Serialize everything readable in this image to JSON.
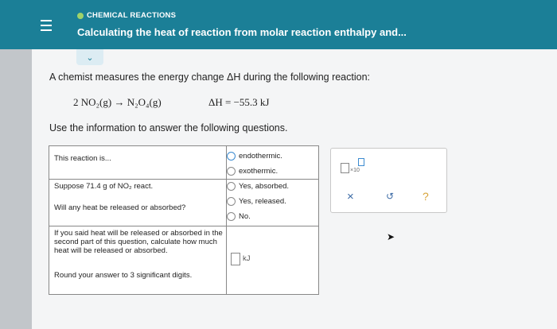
{
  "header": {
    "topic": "CHEMICAL REACTIONS",
    "title": "Calculating the heat of reaction from molar reaction enthalpy and..."
  },
  "question": {
    "prompt": "A chemist measures the energy change ΔH during the following reaction:",
    "reaction": "2 NO₂(g) → N₂O₄(g)",
    "delta_h": "ΔH = −55.3 kJ",
    "instructions": "Use the information to answer the following questions."
  },
  "table": {
    "rows": [
      {
        "label": "This reaction is..."
      },
      {
        "label": "Suppose 71.4 g of NO₂ react."
      },
      {
        "label": "Will any heat be released or absorbed?"
      },
      {
        "label": "If you said heat will be released or absorbed in the second part of this question, calculate how much heat will be released or absorbed."
      },
      {
        "label": "Round your answer to 3 significant digits."
      }
    ],
    "options": [
      "endothermic.",
      "exothermic.",
      "Yes, absorbed.",
      "Yes, released.",
      "No."
    ],
    "unit": "kJ"
  },
  "toolbar": {
    "x10_label": "×10",
    "close_label": "×",
    "undo_label": "↺",
    "help_label": "?"
  },
  "colors": {
    "header_bg": "#1b7f97",
    "page_bg": "#f4f5f6"
  }
}
